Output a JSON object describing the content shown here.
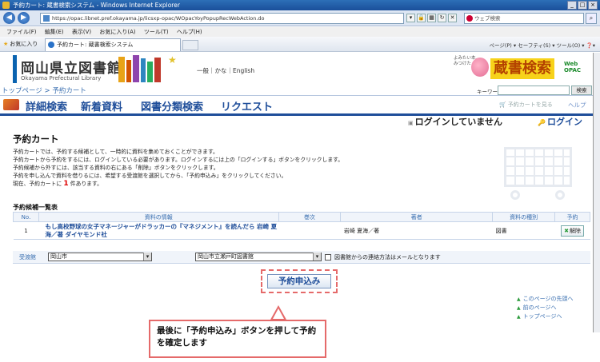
{
  "browser": {
    "title": "予約カート: 蔵書検索システム - Windows Internet Explorer",
    "url": "https://opac.libnet.pref.okayama.jp/licsxp-opac/WOpacYoyPopupRecWebAction.do",
    "search_placeholder": "ウェブ検索",
    "menu": [
      "ファイル(F)",
      "編集(E)",
      "表示(V)",
      "お気に入り(A)",
      "ツール(T)",
      "ヘルプ(H)"
    ],
    "favorites": "お気に入り",
    "tab_title": "予約カート: 蔵書検索システム",
    "command_bar": "ページ(P) ▾  セーフティ(S) ▾  ツール(O) ▾  ❓▾"
  },
  "site": {
    "logo_jp": "岡山県立図書館",
    "logo_en": "Okayama Prefectural Library",
    "lang_links": "一般｜かな｜English",
    "opac_small": "よみたい本、みつけた",
    "opac_big": "蔵書検索",
    "opac_web": "Web\nOPAC"
  },
  "breadcrumb": "トップページ > 予約カート",
  "keyword": {
    "label": "キーワード",
    "button": "検索"
  },
  "nav": {
    "items": [
      "詳細検索",
      "新着資料",
      "図書分類検索",
      "リクエスト"
    ],
    "cart_link": "予約カートを見る",
    "help": "ヘルプ"
  },
  "login": {
    "status": "ログインしていません",
    "link": "ログイン"
  },
  "page": {
    "title": "予約カート",
    "desc": [
      "予約カートでは、予約する候補として、一時的に資料を集めておくことができます。",
      "予約カートから予約をするには、ログインしている必要があります。ログインするには上の「ログインする」ボタンをクリックします。",
      "予約候補から外すには、該当する資料の右にある「削除」ボタンをクリックします。",
      "予約を申し込んで資料を借りるには、希望する受渡館を選択してから、「予約申込み」をクリックしてください。"
    ],
    "count_prefix": "現在、予約カートに",
    "count": "1",
    "count_suffix": "件あります。"
  },
  "list": {
    "title": "予約候補一覧表",
    "headers": [
      "No.",
      "資料の情報",
      "巻次",
      "著者",
      "資料の種別",
      "予約"
    ],
    "rows": [
      {
        "no": "1",
        "title": "もし高校野球の女子マネージャーがドラッカーの『マネジメント』を読んだら 岩崎 夏海／著 ダイヤモンド社",
        "volume": "",
        "author": "岩崎 夏海／著",
        "type": "図書",
        "delete": "解除"
      }
    ]
  },
  "receive": {
    "label": "受渡館",
    "region": "岡山市",
    "library": "岡山市立瀬戸町図書館",
    "contact": "図書館からの連絡方法はメールとなります"
  },
  "submit": "予約申込み",
  "side_links": [
    "このページの先頭へ",
    "前のページへ",
    "トップページへ"
  ],
  "callout": "最後に「予約申込み」ボタンを押して予約を確定します"
}
